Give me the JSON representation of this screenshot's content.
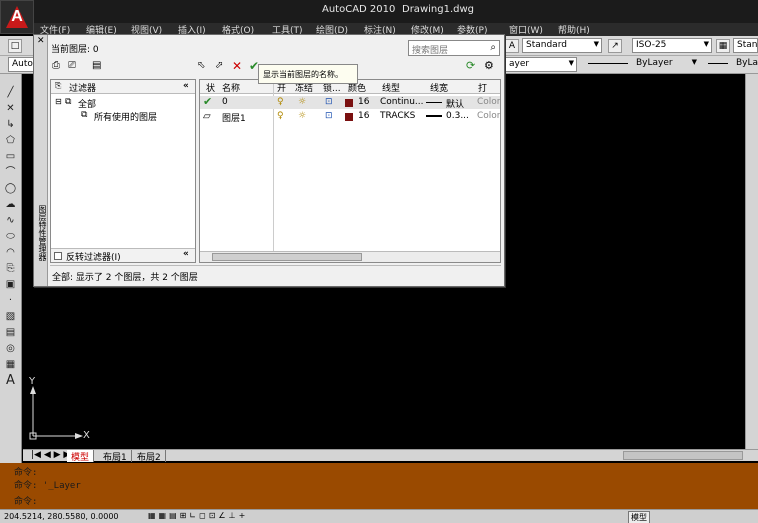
{
  "window": {
    "app_title": "AutoCAD 2010",
    "doc_title": "Drawing1.dwg"
  },
  "menu": [
    "文件(F)",
    "编辑(E)",
    "视图(V)",
    "插入(I)",
    "格式(O)",
    "工具(T)",
    "绘图(D)",
    "标注(N)",
    "修改(M)",
    "参数(P)",
    "窗口(W)",
    "帮助(H)"
  ],
  "toolbar": {
    "text_style": "Standard",
    "dim_style": "ISO-25",
    "table_style": "Stand",
    "left_combo": "Auto",
    "color": "ByLayer",
    "linetype": "ByLayer",
    "lineweight": "ByLay",
    "layer_combo": "ayer"
  },
  "palette": {
    "current_layer": "当前图层: 0",
    "search_placeholder": "搜索图层",
    "filter_header": "过滤器",
    "filter_all": "全部",
    "filter_used": "所有使用的图层",
    "invert_filter": "反转过滤器(I)",
    "tooltip": "显示当前图层的名称。",
    "columns": [
      "状",
      "名称",
      "开",
      "冻结",
      "锁...",
      "颜色",
      "线型",
      "线宽",
      "打印..."
    ],
    "layers": [
      {
        "name": "0",
        "color_num": "16",
        "linetype": "Continu...",
        "lineweight": "默认",
        "plot": "Color"
      },
      {
        "name": "图层1",
        "color_num": "16",
        "linetype": "TRACKS",
        "lineweight": "0.3...",
        "plot": "Color"
      }
    ],
    "status": "全部: 显示了 2 个图层，共 2 个图层",
    "side_title": "图层特性管理器"
  },
  "layout_tabs": [
    "模型",
    "布局1",
    "布局2"
  ],
  "command": {
    "line1": "命令:",
    "line2": "命令: '_Layer",
    "line3": "命令:"
  },
  "statusbar": {
    "coords": "204.5214, 280.5580, 0.0000",
    "model": "模型"
  },
  "ucs": {
    "x": "X",
    "y": "Y"
  },
  "colors": {
    "canvas": "#000000",
    "command_bg": "#9a4a00",
    "layer_color": "#7a1010"
  }
}
